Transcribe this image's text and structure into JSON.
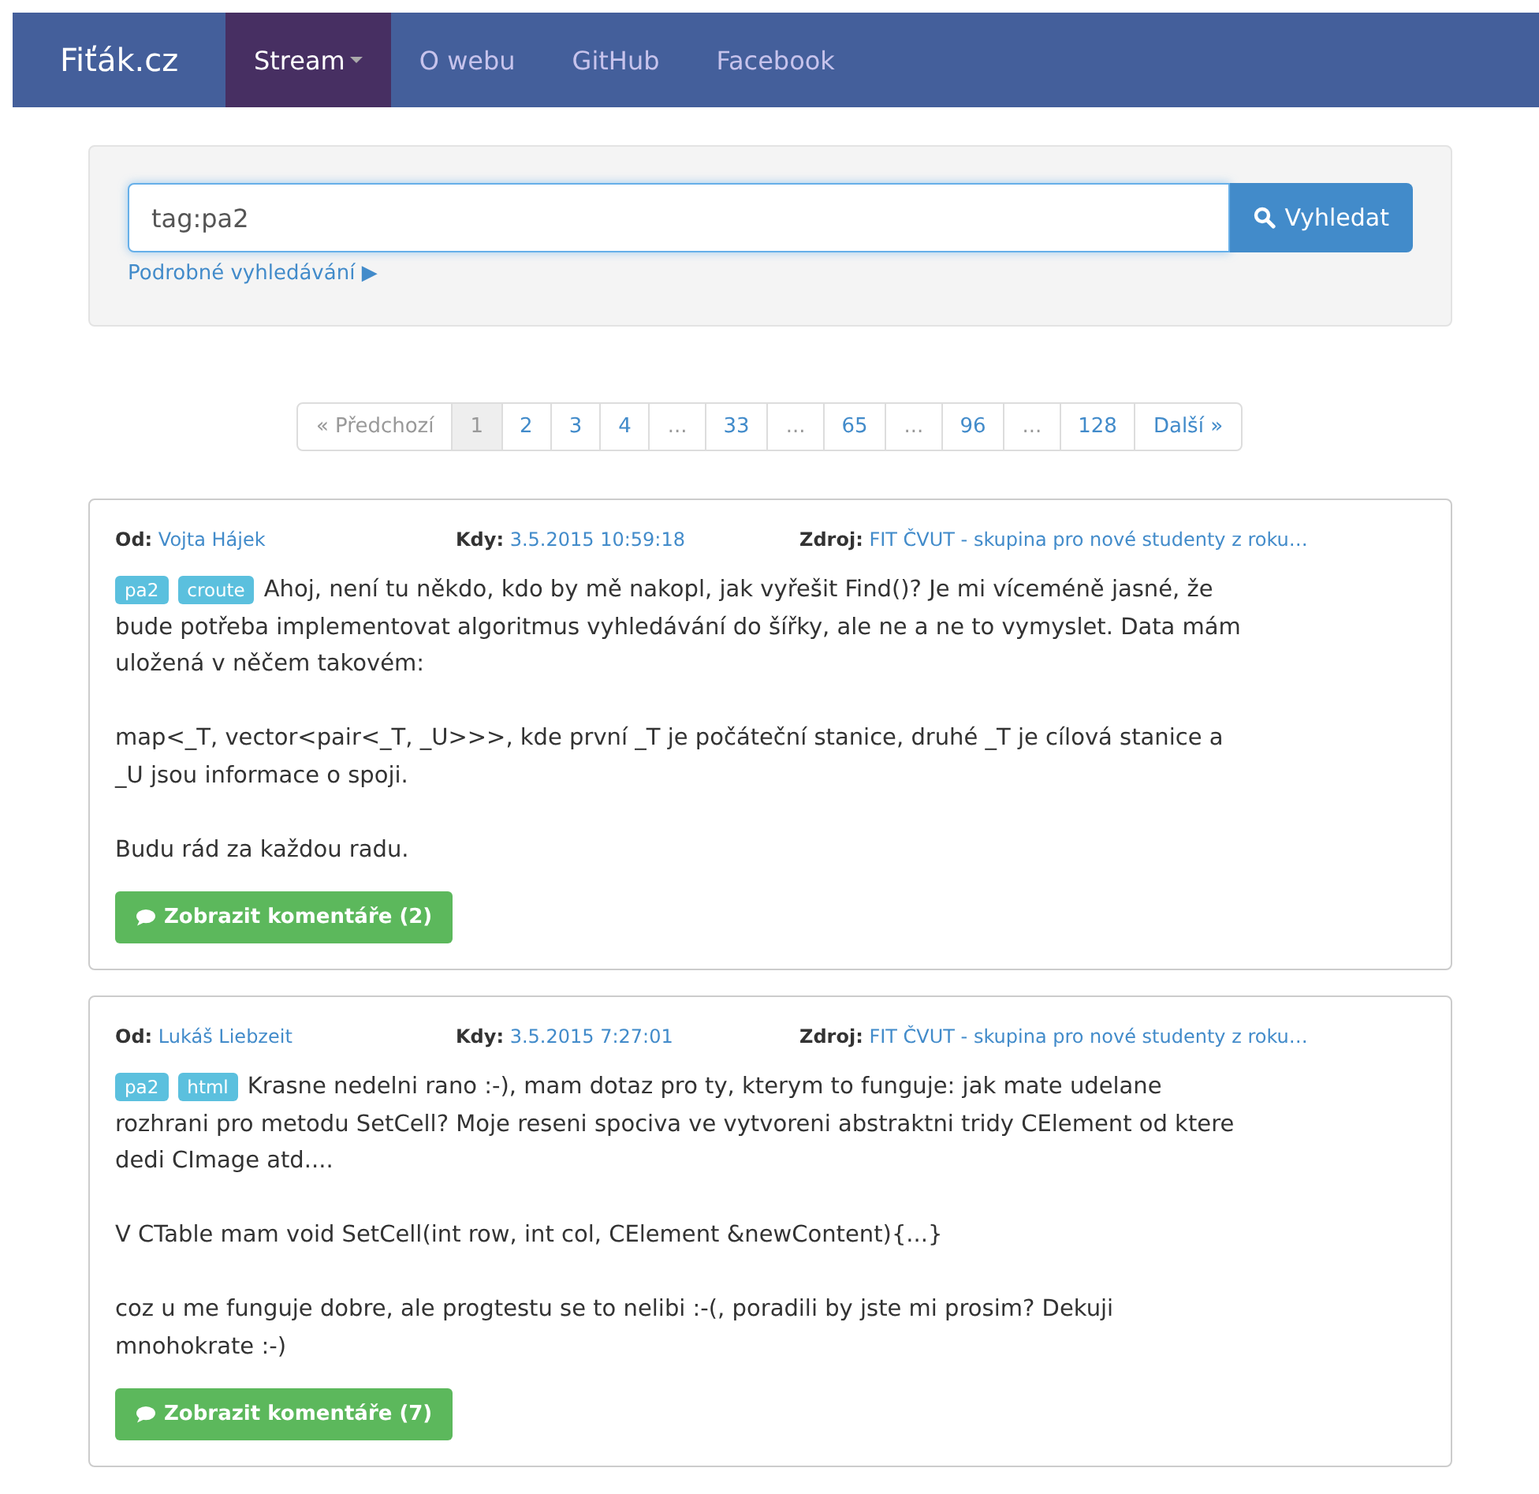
{
  "navbar": {
    "brand": "Fiťák.cz",
    "items": [
      {
        "label": "Stream",
        "selected": true,
        "dropdown": true
      },
      {
        "label": "O webu",
        "selected": false,
        "dropdown": false
      },
      {
        "label": "GitHub",
        "selected": false,
        "dropdown": false
      },
      {
        "label": "Facebook",
        "selected": false,
        "dropdown": false
      }
    ]
  },
  "search": {
    "value": "tag:pa2",
    "button": "Vyhledat",
    "advanced_link": "Podrobné vyhledávání ▶"
  },
  "pagination": [
    {
      "label": "« Předchozí",
      "selected": false,
      "disabled": true
    },
    {
      "label": "1",
      "selected": true,
      "disabled": false
    },
    {
      "label": "2",
      "selected": false,
      "disabled": false
    },
    {
      "label": "3",
      "selected": false,
      "disabled": false
    },
    {
      "label": "4",
      "selected": false,
      "disabled": false
    },
    {
      "label": "...",
      "selected": false,
      "disabled": true
    },
    {
      "label": "33",
      "selected": false,
      "disabled": false
    },
    {
      "label": "...",
      "selected": false,
      "disabled": true
    },
    {
      "label": "65",
      "selected": false,
      "disabled": false
    },
    {
      "label": "...",
      "selected": false,
      "disabled": true
    },
    {
      "label": "96",
      "selected": false,
      "disabled": false
    },
    {
      "label": "...",
      "selected": false,
      "disabled": true
    },
    {
      "label": "128",
      "selected": false,
      "disabled": false
    },
    {
      "label": "Další »",
      "selected": false,
      "disabled": false
    }
  ],
  "posts": [
    {
      "from_label": "Od:",
      "from": "Vojta Hájek",
      "when_label": "Kdy:",
      "when": "3.5.2015 10:59:18",
      "source_label": "Zdroj:",
      "source": "FIT ČVUT - skupina pro nové studenty z roku…",
      "tags": [
        "pa2",
        "croute"
      ],
      "paragraphs": [
        [
          "Ahoj, není tu někdo, kdo by mě nakopl, jak vyřešit Find()? Je mi víceméně jasné, že",
          "bude potřeba implementovat algoritmus vyhledávání do šířky, ale ne a ne to vymyslet. Data mám",
          "uložená v něčem takovém:"
        ],
        [
          "map<_T, vector<pair<_T, _U>>>, kde první _T je počáteční stanice, druhé _T je cílová stanice a",
          "_U jsou informace o spoji."
        ],
        [
          "Budu rád za každou radu."
        ]
      ],
      "comments_button": "Zobrazit komentáře (2)"
    },
    {
      "from_label": "Od:",
      "from": "Lukáš Liebzeit",
      "when_label": "Kdy:",
      "when": "3.5.2015 7:27:01",
      "source_label": "Zdroj:",
      "source": "FIT ČVUT - skupina pro nové studenty z roku…",
      "tags": [
        "pa2",
        "html"
      ],
      "paragraphs": [
        [
          "Krasne nedelni rano :-), mam dotaz pro ty, kterym to funguje: jak mate udelane",
          "rozhrani pro metodu SetCell? Moje reseni spociva ve vytvoreni abstraktni tridy CElement od ktere",
          "dedi CImage atd...."
        ],
        [
          "V CTable mam void SetCell(int row, int col, CElement &newContent){...}"
        ],
        [
          "coz u me funguje dobre, ale progtestu se to nelibi :-(, poradili by jste mi prosim? Dekuji",
          "mnohokrate :-)"
        ]
      ],
      "comments_button": "Zobrazit komentáře (7)"
    }
  ]
}
